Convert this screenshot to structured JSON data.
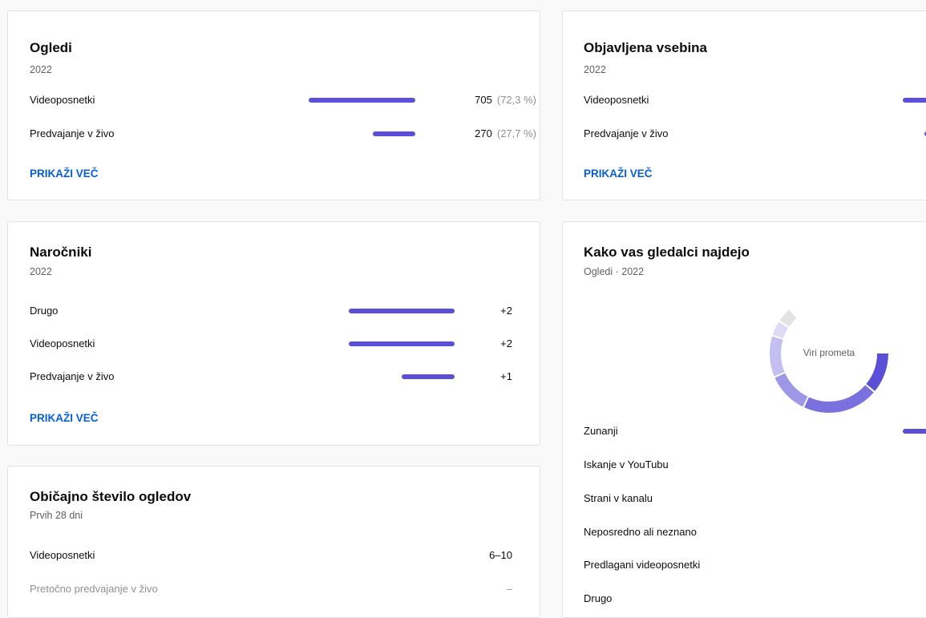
{
  "views": {
    "title": "Ogledi",
    "subtitle": "2022",
    "rows": [
      {
        "label": "Videoposnetki",
        "value": "705",
        "pct": "(72,3 %)",
        "share": 0.723
      },
      {
        "label": "Predvajanje v živo",
        "value": "270",
        "pct": "(27,7 %)",
        "share": 0.277
      }
    ],
    "more_label": "PRIKAŽI VEČ"
  },
  "published": {
    "title": "Objavljena vsebina",
    "subtitle": "2022",
    "rows": [
      {
        "label": "Videoposnetki"
      },
      {
        "label": "Predvajanje v živo"
      }
    ],
    "more_label": "PRIKAŽI VEČ"
  },
  "subscribers": {
    "title": "Naročniki",
    "subtitle": "2022",
    "rows": [
      {
        "label": "Drugo",
        "value": "+2",
        "share": 1.0
      },
      {
        "label": "Videoposnetki",
        "value": "+2",
        "share": 1.0
      },
      {
        "label": "Predvajanje v živo",
        "value": "+1",
        "share": 0.5
      }
    ],
    "more_label": "PRIKAŽI VEČ"
  },
  "typical_views": {
    "title": "Običajno število ogledov",
    "subtitle": "Prvih 28 dni",
    "rows": [
      {
        "label": "Videoposnetki",
        "value": "6–10"
      },
      {
        "label": "Pretočno predvajanje v živo",
        "value": "–"
      }
    ]
  },
  "traffic": {
    "title": "Kako vas gledalci najdejo",
    "subtitle": "Ogledi · 2022",
    "donut_label": "Viri prometa",
    "sources": [
      {
        "label": "Zunanji"
      },
      {
        "label": "Iskanje v YouTubu"
      },
      {
        "label": "Strani v kanalu"
      },
      {
        "label": "Neposredno ali neznano"
      },
      {
        "label": "Predlagani videoposnetki"
      },
      {
        "label": "Drugo"
      }
    ]
  },
  "colors": {
    "accent": "#5a4fd6",
    "link": "#065fd4"
  }
}
